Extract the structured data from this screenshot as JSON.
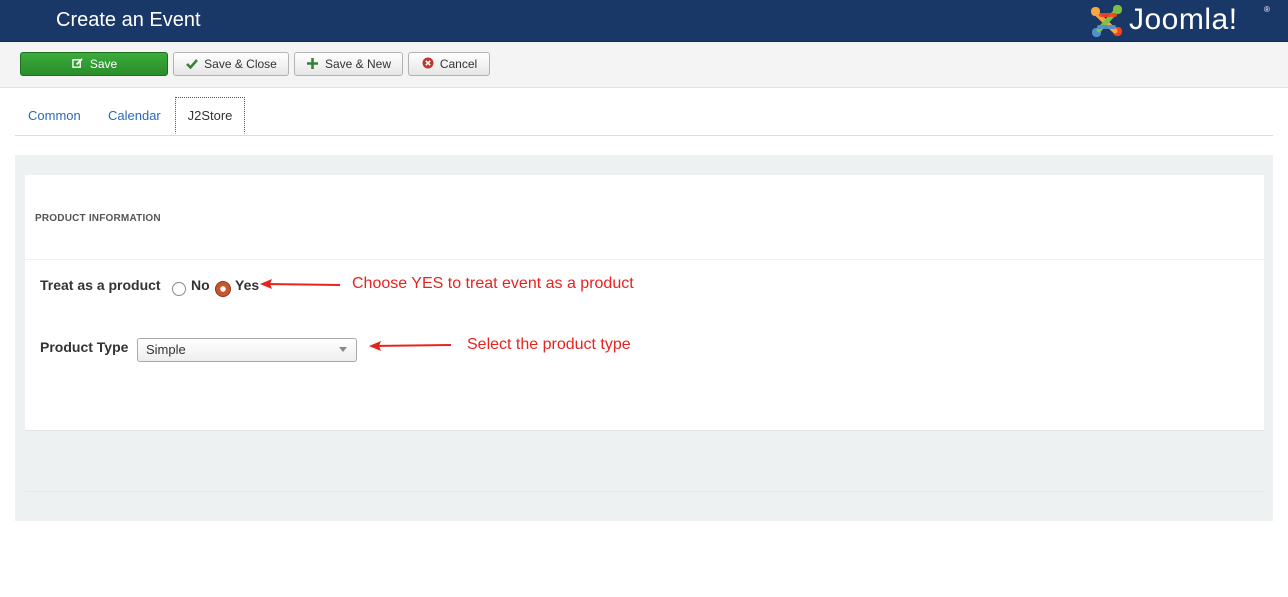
{
  "header": {
    "title": "Create an Event",
    "logo_text": "Joomla!",
    "logo_reg": "®"
  },
  "toolbar": {
    "save_label": "Save",
    "save_close_label": "Save & Close",
    "save_new_label": "Save & New",
    "cancel_label": "Cancel"
  },
  "tabs": [
    {
      "label": "Common",
      "active": false
    },
    {
      "label": "Calendar",
      "active": false
    },
    {
      "label": "J2Store",
      "active": true
    }
  ],
  "panel": {
    "section_title": "PRODUCT INFORMATION",
    "treat_label": "Treat as a product",
    "treat_options": [
      "No",
      "Yes"
    ],
    "treat_selected": "Yes",
    "type_label": "Product Type",
    "type_value": "Simple"
  },
  "annotations": {
    "treat_note": "Choose YES to treat event as a product",
    "type_note": "Select the product type",
    "color": "#e8231f"
  },
  "colors": {
    "header_bg": "#1a3867",
    "save_button": "#2f9a2f",
    "tab_link": "#2a69b8"
  },
  "icons": {
    "save": "edit-icon",
    "save_close": "checkmark-icon",
    "save_new": "plus-icon",
    "cancel": "cancel-circle-icon"
  }
}
